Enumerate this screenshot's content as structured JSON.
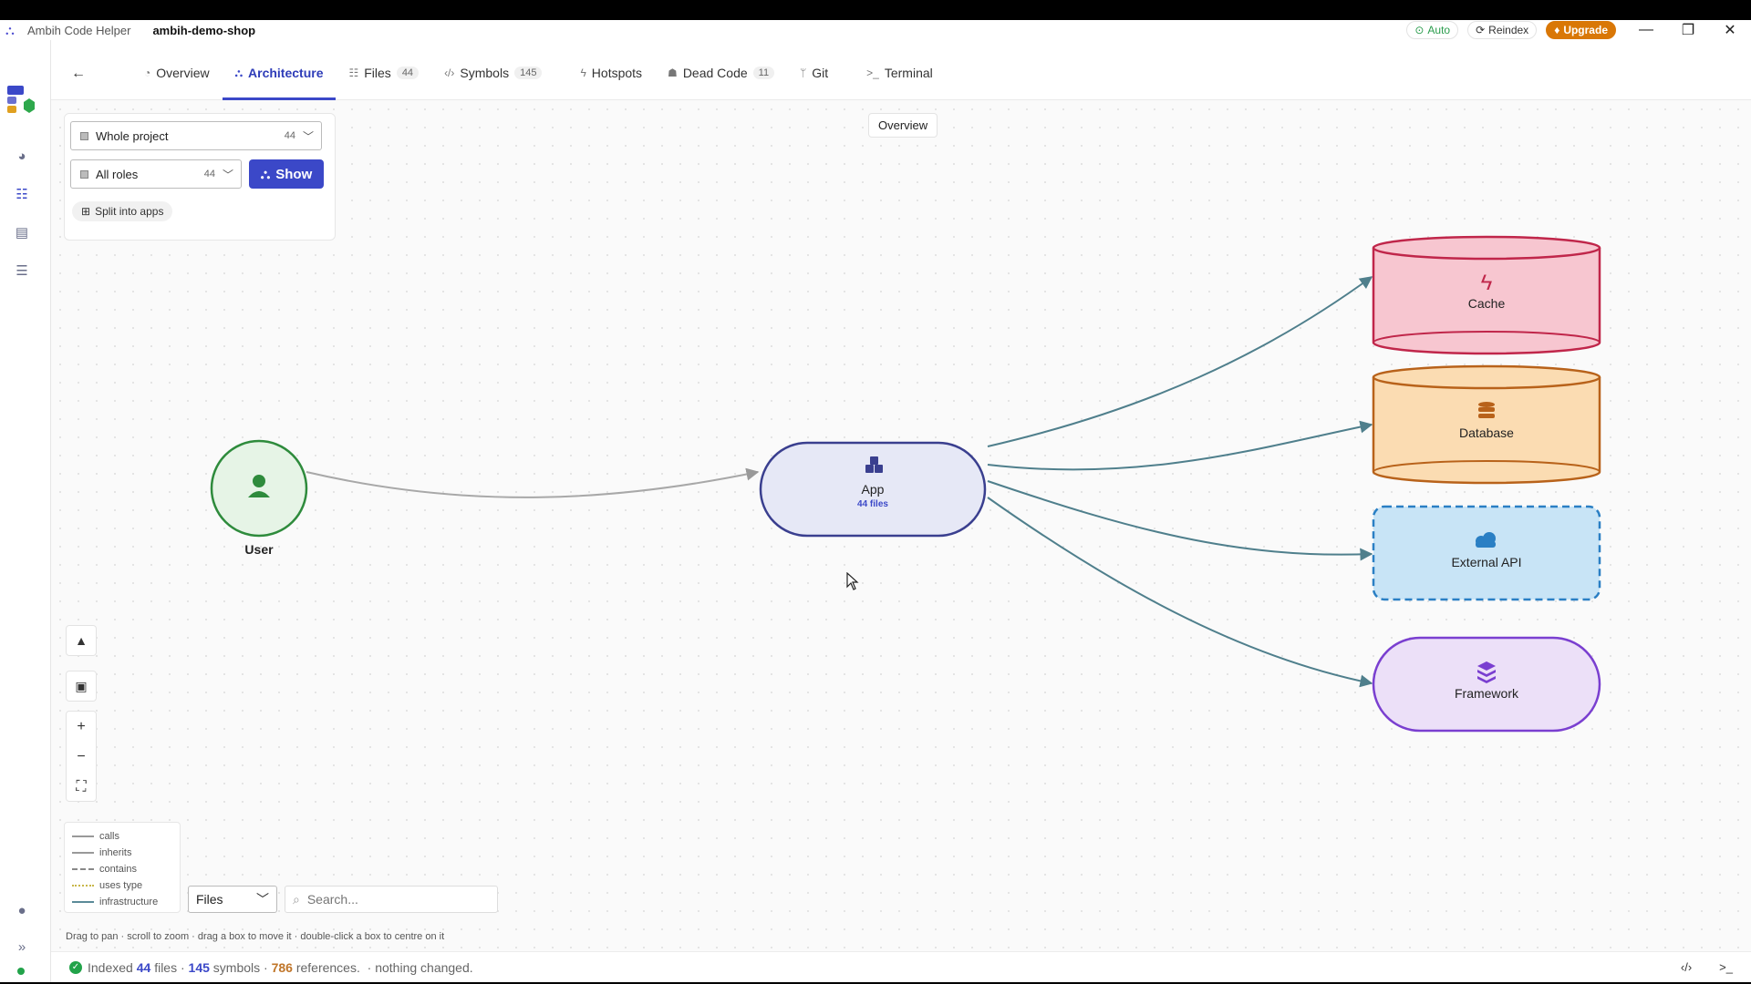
{
  "titlebar": {
    "app_name": "Ambih Code Helper",
    "project": "ambih-demo-shop",
    "auto": "Auto",
    "reindex": "Reindex",
    "upgrade": "Upgrade"
  },
  "tabs": [
    {
      "label": "Overview",
      "icon": "overview-icon"
    },
    {
      "label": "Architecture",
      "icon": "architecture-icon",
      "active": true
    },
    {
      "label": "Files",
      "count": "44",
      "icon": "files-icon"
    },
    {
      "label": "Symbols",
      "count": "145",
      "icon": "code-icon"
    },
    {
      "label": "Hotspots",
      "icon": "flame-icon"
    },
    {
      "label": "Dead Code",
      "count": "11",
      "icon": "skull-icon"
    },
    {
      "label": "Git",
      "icon": "branch-icon"
    },
    {
      "label": "Terminal",
      "icon": "terminal-icon"
    }
  ],
  "filters": {
    "scope": "Whole project",
    "scope_count": "44",
    "roles": "All roles",
    "roles_count": "44",
    "show": "Show",
    "split": "Split into apps"
  },
  "overview_chip": "Overview",
  "graph": {
    "nodes": {
      "user": "User",
      "app": "App",
      "app_sub": "44 files",
      "cache": "Cache",
      "database": "Database",
      "external_api": "External API",
      "framework": "Framework"
    }
  },
  "legend": [
    "calls",
    "inherits",
    "contains",
    "uses type",
    "infrastructure"
  ],
  "bottom": {
    "view_select": "Files",
    "search_placeholder": "Search...",
    "hint": "Drag to pan · scroll to zoom · drag a box to move it · double-click a box to centre on it"
  },
  "status": {
    "indexed": "Indexed",
    "files_count": "44",
    "files_word": "files ·",
    "symbols_count": "145",
    "symbols_word": "symbols ·",
    "refs_count": "786",
    "refs_word": "references.",
    "changes": "· nothing changed."
  },
  "colors": {
    "accent": "#3b48c8",
    "user": "#2e8b3c",
    "cache": "#c0264a",
    "database": "#b8621a",
    "external_api": "#2a7fc4",
    "framework": "#7a3fd0"
  }
}
